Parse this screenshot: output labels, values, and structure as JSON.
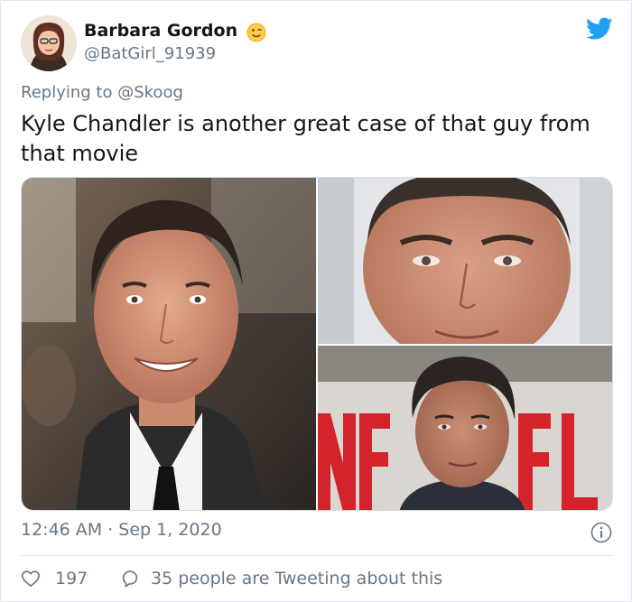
{
  "author": {
    "name": "Barbara Gordon",
    "handle": "@BatGirl_91939",
    "emoji": "wink-emoji"
  },
  "tweet": {
    "reply_prefix": "Replying to",
    "reply_to": "@Skoog",
    "text": "Kyle Chandler is another great case of that guy from that movie",
    "timestamp": "12:46 AM · Sep 1, 2020"
  },
  "media": {
    "photos": [
      {
        "name": "photo-red-carpet-smiling-man"
      },
      {
        "name": "photo-closeup-face"
      },
      {
        "name": "photo-man-in-front-of-sign"
      }
    ]
  },
  "actions": {
    "like_count": "197",
    "conversation_label": "35 people are Tweeting about this"
  },
  "colors": {
    "twitter_blue": "#1da1f2",
    "text_primary": "#14171a",
    "text_secondary": "#657786",
    "divider": "#e1e8ed"
  }
}
